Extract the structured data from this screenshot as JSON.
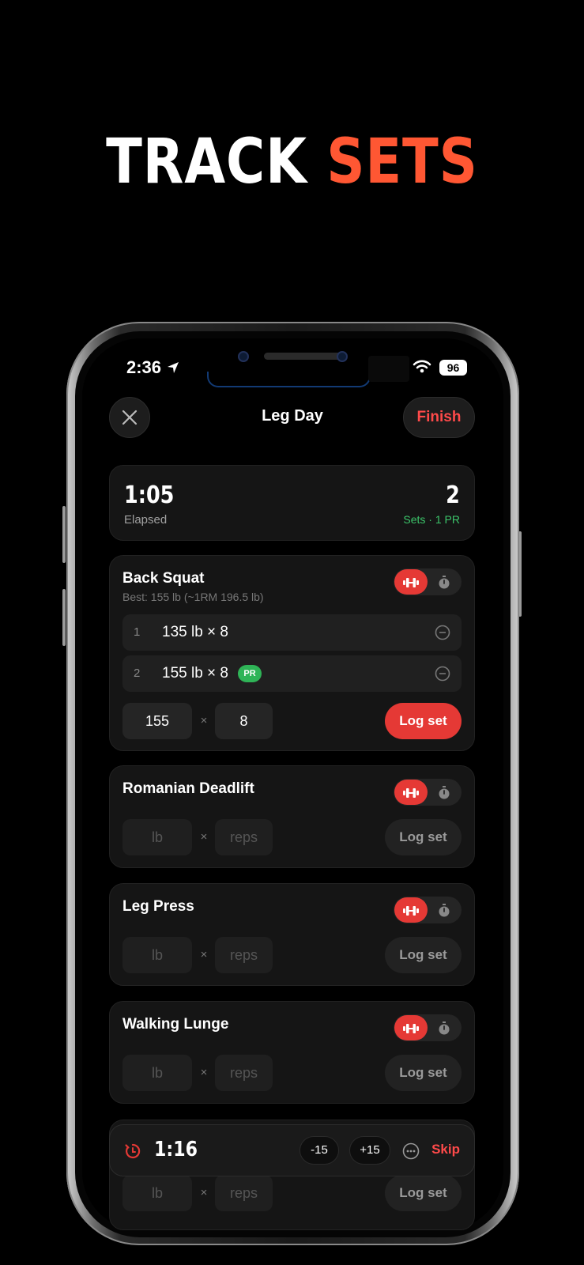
{
  "headline": {
    "word1": "TRACK",
    "word2": "SETS"
  },
  "status_bar": {
    "time": "2:36",
    "battery": "96"
  },
  "header": {
    "title": "Leg Day",
    "finish_label": "Finish"
  },
  "stats": {
    "elapsed_value": "1:05",
    "elapsed_label": "Elapsed",
    "sets_value": "2",
    "sets_label": "Sets · 1 PR"
  },
  "exercises": [
    {
      "name": "Back Squat",
      "best": "Best: 155 lb (~1RM 196.5 lb)",
      "sets": [
        {
          "num": "1",
          "value": "135 lb × 8"
        },
        {
          "num": "2",
          "value": "155 lb × 8",
          "badge": "PR"
        }
      ],
      "weight": "155",
      "reps": "8",
      "log_label": "Log set"
    },
    {
      "name": "Romanian Deadlift",
      "weight_placeholder": "lb",
      "reps_placeholder": "reps",
      "log_label": "Log set"
    },
    {
      "name": "Leg Press",
      "weight_placeholder": "lb",
      "reps_placeholder": "reps",
      "log_label": "Log set"
    },
    {
      "name": "Walking Lunge",
      "weight_placeholder": "lb",
      "reps_placeholder": "reps",
      "log_label": "Log set"
    },
    {
      "weight_placeholder": "lb",
      "reps_placeholder": "reps",
      "log_label": "Log set"
    }
  ],
  "times_symbol": "×",
  "rest_timer": {
    "time": "1:16",
    "minus_label": "-15",
    "plus_label": "+15",
    "skip_label": "Skip"
  },
  "colors": {
    "accent": "#ff5733",
    "danger": "#e53935",
    "success": "#2fb457",
    "background": "#000000",
    "card": "#151515"
  },
  "icons": [
    "close-icon",
    "location-arrow-icon",
    "wifi-icon",
    "dumbbell-icon",
    "stopwatch-icon",
    "remove-circle-icon",
    "timer-icon",
    "more-icon"
  ]
}
